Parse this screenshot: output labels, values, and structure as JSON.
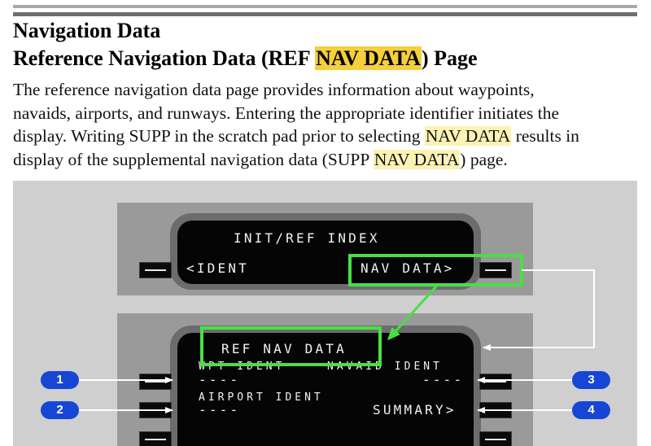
{
  "heading": {
    "title": "Navigation Data",
    "subtitle_pre": "Reference Navigation Data (REF ",
    "subtitle_hl": "NAV DATA",
    "subtitle_post": ") Page"
  },
  "body_text": {
    "l1": "The reference navigation data page provides information about waypoints,",
    "l2": "navaids, airports, and runways. Entering the appropriate identifier initiates the",
    "l3_pre": "display. Writing SUPP in the scratch pad prior to selecting ",
    "l3_hl": "NAV DATA",
    "l3_post": " results in",
    "l4_pre": "display of the supplemental navigation data (SUPP ",
    "l4_hl": "NAV DATA",
    "l4_post": ") page."
  },
  "cdu_top": {
    "title": "INIT/REF INDEX",
    "left_1": "<IDENT",
    "right_1": "NAV DATA>"
  },
  "cdu_bottom": {
    "title": "REF NAV DATA",
    "wpt_label": "WPT IDENT",
    "navaid_label": "NAVAID IDENT",
    "wpt_value": "----",
    "navaid_value": "----",
    "airport_label": "AIRPORT IDENT",
    "airport_value": "----",
    "summary": "SUMMARY>"
  },
  "callouts": [
    "1",
    "2",
    "3",
    "4"
  ],
  "colors": {
    "highlight_box": "#47e044",
    "callout_badge": "#1746d6",
    "heading_highlight": "#f5cf3c",
    "text_highlight": "#fbf2b4"
  }
}
